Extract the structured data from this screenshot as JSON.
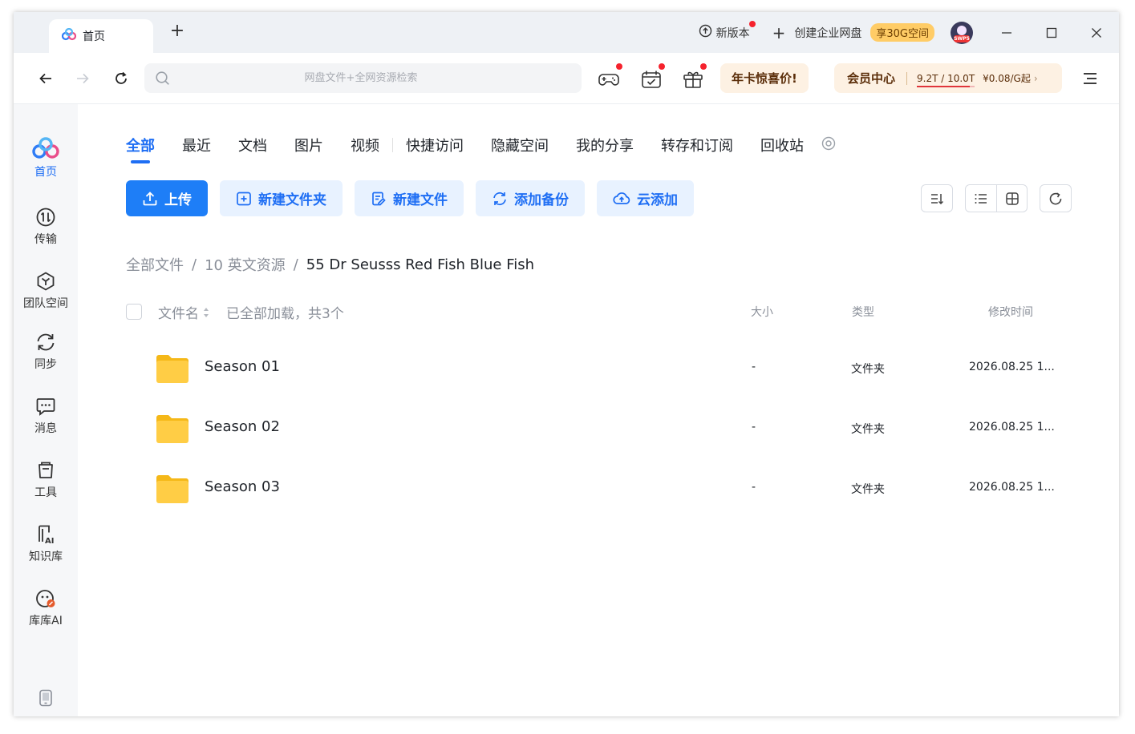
{
  "titlebar": {
    "tab_label": "首页",
    "new_version": "新版本",
    "create_enterprise": "创建企业网盘",
    "enterprise_badge": "享30G空间",
    "avatar_label": "SWP5"
  },
  "toolbar": {
    "search_placeholder": "网盘文件+全网资源检索",
    "promo": "年卡惊喜价!",
    "vip_title": "会员中心",
    "quota": "9.2T / 10.0T",
    "quota_fraction": 0.92,
    "price": "¥0.08/G起"
  },
  "sidebar": {
    "items": [
      {
        "label": "首页",
        "icon": "netdisk-logo-icon"
      },
      {
        "label": "传输",
        "icon": "transfer-icon"
      },
      {
        "label": "团队空间",
        "icon": "team-space-icon"
      },
      {
        "label": "同步",
        "icon": "sync-icon"
      },
      {
        "label": "消息",
        "icon": "message-icon"
      },
      {
        "label": "工具",
        "icon": "tools-icon"
      },
      {
        "label": "知识库",
        "icon": "knowledge-base-icon"
      },
      {
        "label": "库库AI",
        "icon": "kuku-ai-icon"
      }
    ]
  },
  "main": {
    "tabs": [
      "全部",
      "最近",
      "文档",
      "图片",
      "视频",
      "快捷访问",
      "隐藏空间",
      "我的分享",
      "转存和订阅",
      "回收站"
    ],
    "actions": {
      "upload": "上传",
      "new_folder": "新建文件夹",
      "new_file": "新建文件",
      "add_backup": "添加备份",
      "cloud_add": "云添加"
    },
    "breadcrumb": [
      "全部文件",
      "10 英文资源",
      "55 Dr Seusss Red Fish Blue Fish"
    ],
    "table": {
      "col_name": "文件名",
      "summary": "已全部加载，共3个",
      "col_size": "大小",
      "col_type": "类型",
      "col_mtime": "修改时间",
      "rows": [
        {
          "name": "Season 01",
          "size": "-",
          "type": "文件夹",
          "mtime": "2026.08.25 1..."
        },
        {
          "name": "Season 02",
          "size": "-",
          "type": "文件夹",
          "mtime": "2026.08.25 1..."
        },
        {
          "name": "Season 03",
          "size": "-",
          "type": "文件夹",
          "mtime": "2026.08.25 1..."
        }
      ]
    }
  },
  "colors": {
    "accent": "#1e7ef7",
    "folder": "#ffc93c",
    "promo_bg": "#fdf1e3",
    "red_dot": "#f5222d"
  }
}
